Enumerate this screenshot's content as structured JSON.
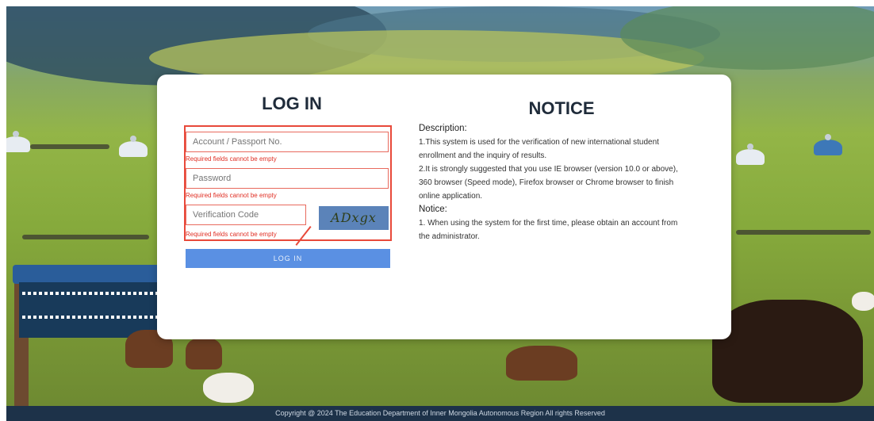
{
  "login": {
    "title": "LOG IN",
    "username_placeholder": "Account / Passport No.",
    "password_placeholder": "Password",
    "code_placeholder": "Verification Code",
    "captcha_text": "ADxgx",
    "error_required": "Required fields cannot be empty",
    "login_button": "LOG IN"
  },
  "notice": {
    "title": "NOTICE",
    "description_heading": "Description:",
    "desc1": "1.This system is used for the verification of new international student enrollment and the inquiry of results.",
    "desc2": "2.It is strongly suggested that you use IE browser (version 10.0 or above), 360 browser (Speed mode), Firefox browser or Chrome browser to finish online application.",
    "notice_heading": "Notice:",
    "notice1": "1. When using the system for the first time, please obtain an account from the administrator."
  },
  "footer": {
    "copyright": "Copyright @ 2024 The Education Department of Inner Mongolia Autonomous Region All rights Reserved"
  },
  "colors": {
    "error": "#e03025",
    "button": "#5a90e3",
    "footer_bg": "#1d3249"
  }
}
